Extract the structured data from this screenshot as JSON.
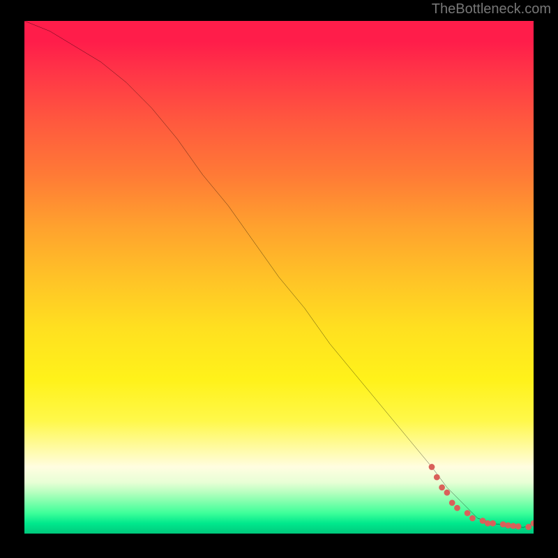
{
  "watermark": "TheBottleneck.com",
  "chart_data": {
    "type": "line",
    "title": "",
    "xlabel": "",
    "ylabel": "",
    "xlim": [
      0,
      100
    ],
    "ylim": [
      0,
      100
    ],
    "grid": false,
    "legend": false,
    "gradient_stops": [
      {
        "pos": 0,
        "color": "#ff1d4a"
      },
      {
        "pos": 10,
        "color": "#ff3547"
      },
      {
        "pos": 20,
        "color": "#ff5a3e"
      },
      {
        "pos": 30,
        "color": "#ff7a36"
      },
      {
        "pos": 40,
        "color": "#ffa12e"
      },
      {
        "pos": 50,
        "color": "#ffc227"
      },
      {
        "pos": 60,
        "color": "#ffe020"
      },
      {
        "pos": 70,
        "color": "#fff21a"
      },
      {
        "pos": 78,
        "color": "#fff84a"
      },
      {
        "pos": 87,
        "color": "#fffde0"
      },
      {
        "pos": 92,
        "color": "#b6ffbf"
      },
      {
        "pos": 96,
        "color": "#3eff9a"
      },
      {
        "pos": 100,
        "color": "#00c97d"
      }
    ],
    "series": [
      {
        "name": "bottleneck-curve",
        "color": "#000000",
        "x": [
          0,
          5,
          10,
          15,
          20,
          25,
          30,
          35,
          40,
          45,
          50,
          55,
          60,
          65,
          70,
          75,
          80,
          83,
          86,
          89,
          92,
          95,
          98,
          100
        ],
        "y": [
          100,
          98,
          95,
          92,
          88,
          83,
          77,
          70,
          64,
          57,
          50,
          44,
          37,
          31,
          25,
          19,
          13,
          9,
          6,
          3,
          2,
          1.5,
          1.2,
          2
        ]
      }
    ],
    "scatter": {
      "name": "data-points",
      "color": "#d9605a",
      "x": [
        80,
        81,
        82,
        83,
        84,
        85,
        87,
        88,
        90,
        91,
        92,
        94,
        95,
        96,
        97,
        99,
        100
      ],
      "y": [
        13,
        11,
        9,
        8,
        6,
        5,
        4,
        3,
        2.5,
        2,
        2,
        1.8,
        1.6,
        1.5,
        1.4,
        1.3,
        2
      ]
    }
  }
}
